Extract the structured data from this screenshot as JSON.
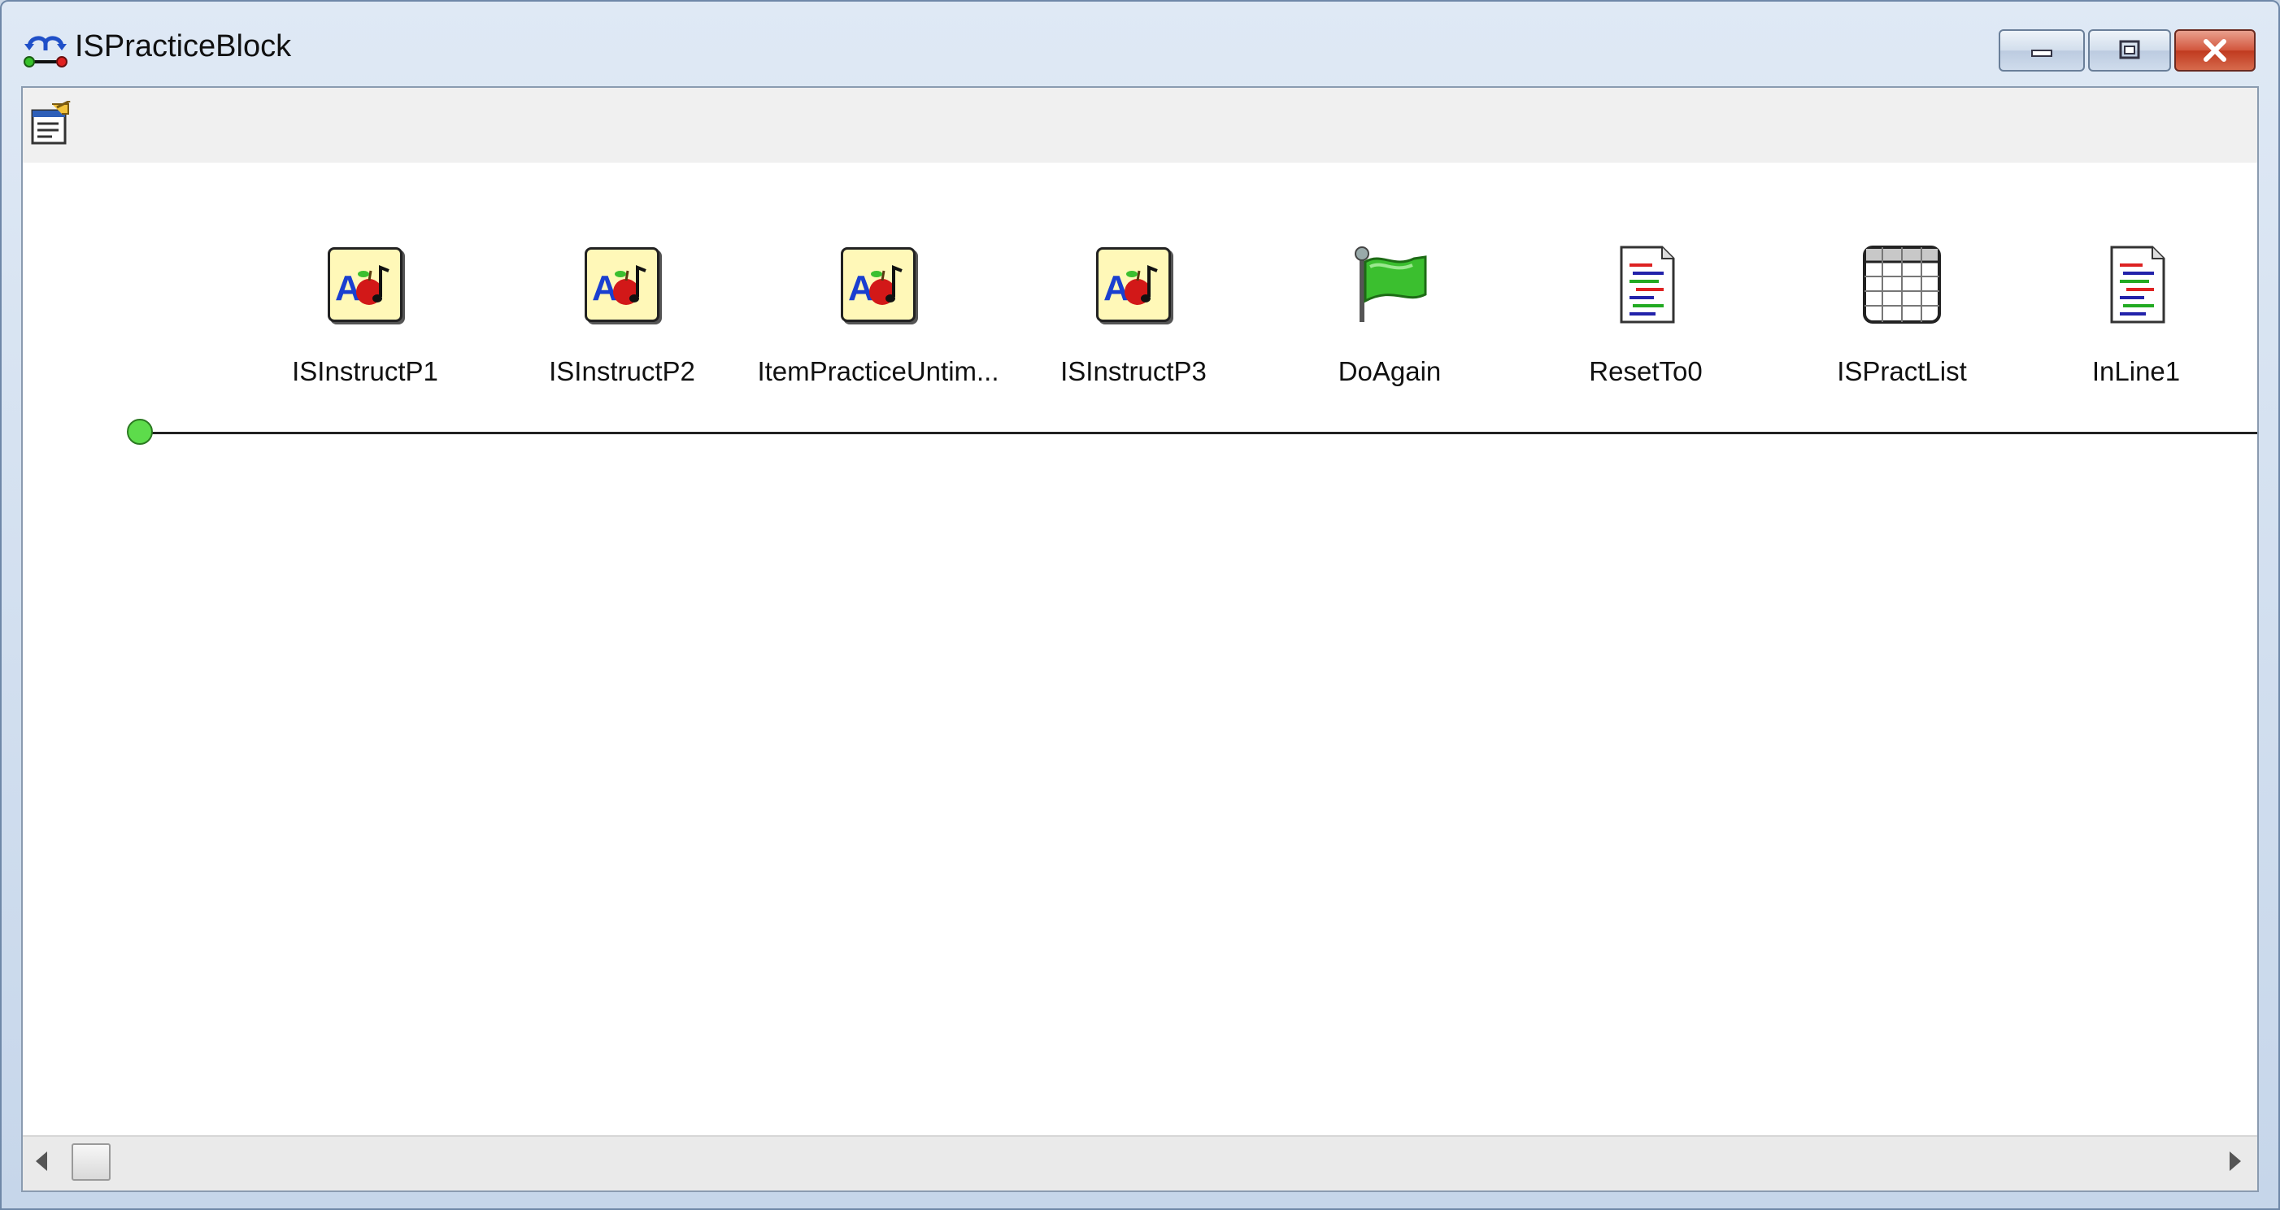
{
  "window": {
    "title": "ISPracticeBlock",
    "icon": "procedure-icon"
  },
  "toolbar": {
    "properties_icon": "properties-icon"
  },
  "timeline": {
    "nodes": [
      {
        "label": "ISInstructP1",
        "icon": "slide-icon"
      },
      {
        "label": "ISInstructP2",
        "icon": "slide-icon"
      },
      {
        "label": "ItemPracticeUntim...",
        "icon": "slide-icon"
      },
      {
        "label": "ISInstructP3",
        "icon": "slide-icon"
      },
      {
        "label": "DoAgain",
        "icon": "label-flag-icon"
      },
      {
        "label": "ResetTo0",
        "icon": "inline-script-icon"
      },
      {
        "label": "ISPractList",
        "icon": "list-icon"
      },
      {
        "label": "InLine1",
        "icon": "inline-script-icon"
      }
    ]
  },
  "colors": {
    "start_node": "#5ddc4b",
    "flag": "#3bbf2f",
    "slide_bg": "#fff8b8",
    "close_button": "#c03a1f"
  }
}
